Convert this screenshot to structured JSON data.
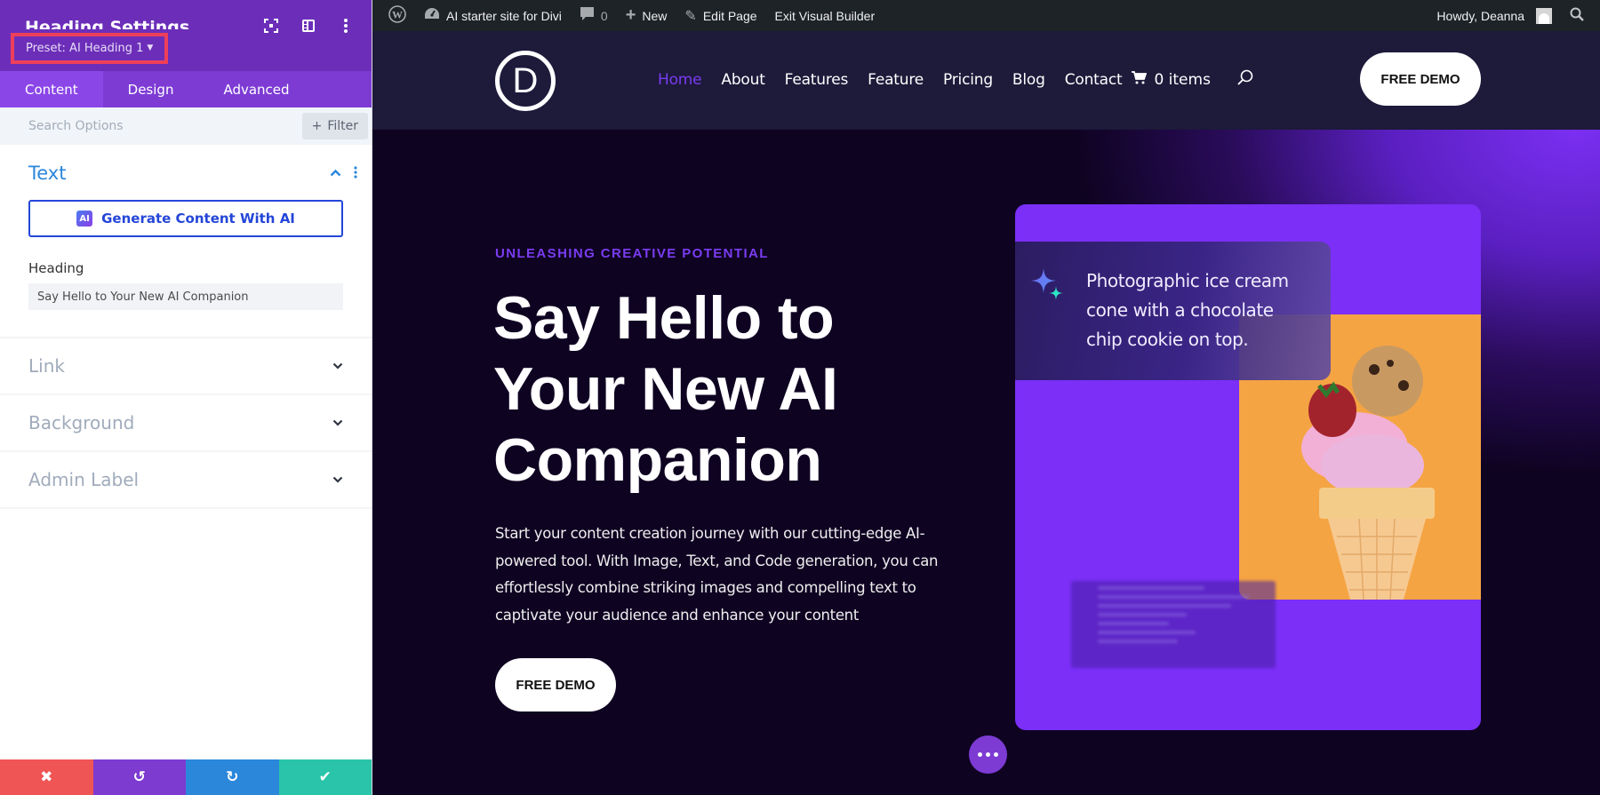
{
  "panel": {
    "title": "Heading Settings",
    "preset_label": "Preset: AI Heading 1",
    "header_icons": [
      "expand-icon",
      "split-view-icon",
      "more-options-icon"
    ],
    "tabs": [
      {
        "label": "Content",
        "active": true
      },
      {
        "label": "Design",
        "active": false
      },
      {
        "label": "Advanced",
        "active": false
      }
    ],
    "search": {
      "placeholder": "Search Options",
      "value": ""
    },
    "filter_label": "Filter",
    "open_section": {
      "title": "Text",
      "ai_button_label": "Generate Content With AI",
      "ai_badge": "AI",
      "field_label": "Heading",
      "field_value": "Say Hello to Your New AI Companion"
    },
    "closed_sections": [
      "Link",
      "Background",
      "Admin Label"
    ],
    "footer": {
      "cancel": "✖",
      "undo": "↺",
      "redo": "↻",
      "save": "✔"
    },
    "colors": {
      "header": "#6c2eb9",
      "tabs": "#7d3bd4",
      "accent_blue": "#2b87da",
      "cancel": "#ef5555",
      "undo": "#7e3bd0",
      "redo": "#2b87da",
      "save": "#29c4a9",
      "highlight": "#ee3f5a"
    }
  },
  "admin_bar": {
    "site_name": "AI starter site for Divi",
    "comments_count": "0",
    "new_label": "New",
    "edit_label": "Edit Page",
    "exit_label": "Exit Visual Builder",
    "greeting": "Howdy, Deanna"
  },
  "site": {
    "logo_letter": "D",
    "nav": [
      {
        "label": "Home",
        "active": true
      },
      {
        "label": "About",
        "active": false
      },
      {
        "label": "Features",
        "active": false
      },
      {
        "label": "Feature",
        "active": false
      },
      {
        "label": "Pricing",
        "active": false
      },
      {
        "label": "Blog",
        "active": false
      },
      {
        "label": "Contact",
        "active": false
      }
    ],
    "cart_label": "0 items",
    "header_cta": "FREE DEMO",
    "accent": "#7a3cf0"
  },
  "hero": {
    "eyebrow": "UNLEASHING CREATIVE POTENTIAL",
    "title": "Say Hello to Your New AI Companion",
    "body": "Start your content creation journey with our cutting-edge AI-powered tool. With Image, Text, and Code generation, you can effortlessly combine striking images and compelling text to captivate your audience and enhance your content",
    "cta": "FREE DEMO",
    "prompt_text": "Photographic ice cream cone with a chocolate chip cookie on top.",
    "card_color": "#7b2ff7"
  }
}
